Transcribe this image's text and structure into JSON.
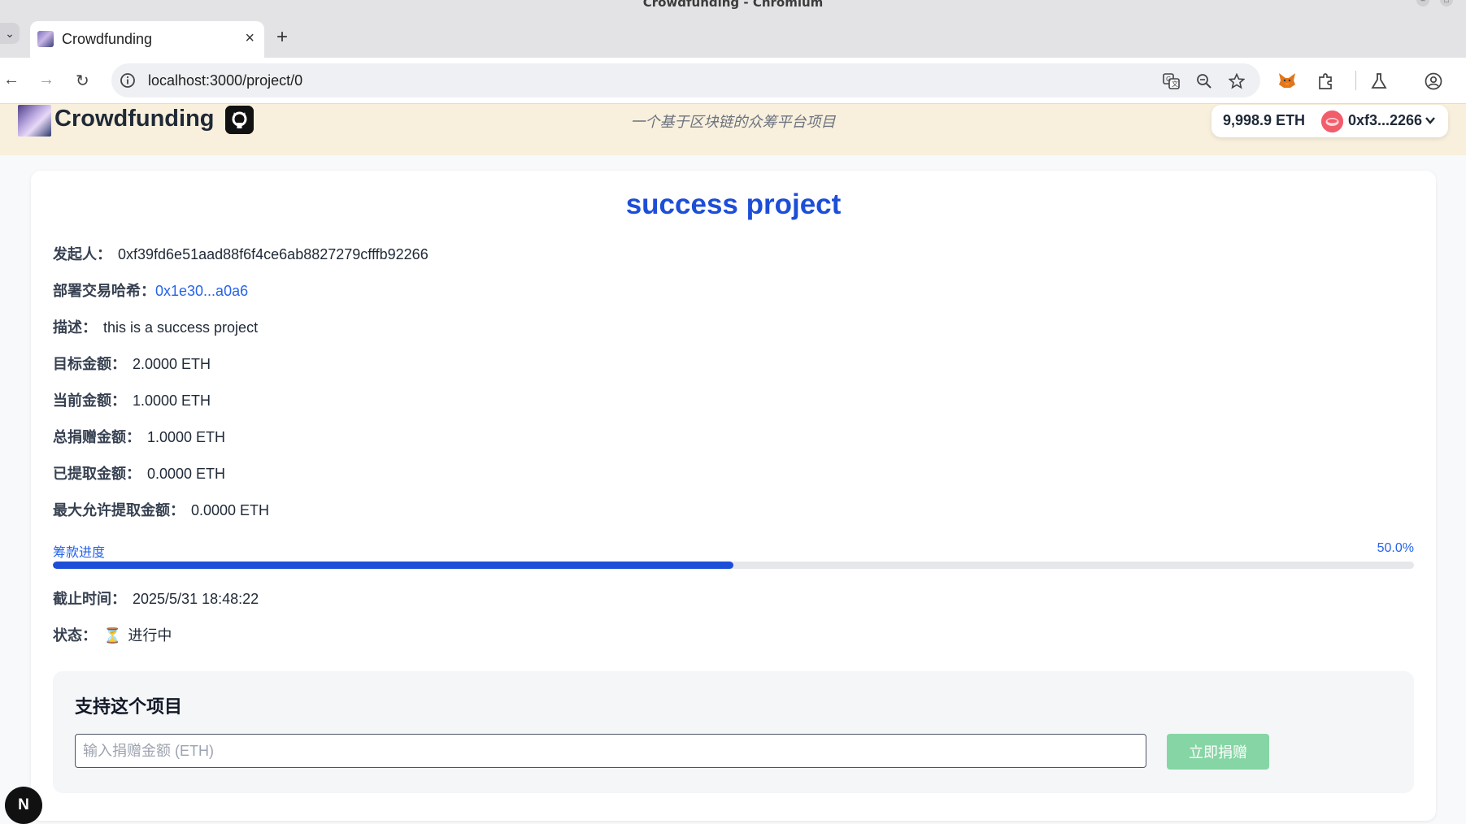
{
  "browser": {
    "window_title": "Crowdfunding - Chromium",
    "tab": {
      "title": "Crowdfunding",
      "close_glyph": "×"
    },
    "new_tab_glyph": "+",
    "tab_list_glyph": "⌄",
    "back_glyph": "←",
    "forward_glyph": "→",
    "reload_glyph": "↻",
    "url": "localhost:3000/project/0",
    "icons": [
      "translate-icon",
      "zoom-icon",
      "bookmark-star-icon",
      "metamask-fox-icon",
      "extensions-icon",
      "labs-flask-icon",
      "profile-icon"
    ]
  },
  "header": {
    "brand": "Crowdfunding",
    "tagline": "一个基于区块链的众筹平台项目",
    "wallet": {
      "balance": "9,998.9 ETH",
      "address": "0xf3...2266"
    }
  },
  "project": {
    "title": "success project",
    "fields": {
      "initiator": {
        "label": "发起人：",
        "value": "0xf39fd6e51aad88f6f4ce6ab8827279cfffb92266"
      },
      "deploy_tx": {
        "label": "部署交易哈希：",
        "value": "0x1e30...a0a6"
      },
      "description": {
        "label": "描述：",
        "value": "this is a success project"
      },
      "target": {
        "label": "目标金额：",
        "value": "2.0000 ETH"
      },
      "current": {
        "label": "当前金额：",
        "value": "1.0000 ETH"
      },
      "total_donated": {
        "label": "总捐赠金额：",
        "value": "1.0000 ETH"
      },
      "withdrawn": {
        "label": "已提取金额：",
        "value": "0.0000 ETH"
      },
      "max_withdraw": {
        "label": "最大允许提取金额：",
        "value": "0.0000 ETH"
      },
      "deadline": {
        "label": "截止时间：",
        "value": "2025/5/31 18:48:22"
      },
      "status": {
        "label": "状态：",
        "icon": "⏳",
        "value": "进行中"
      }
    },
    "progress": {
      "label": "筹款进度",
      "percent_text": "50.0%",
      "fraction": 0.5
    }
  },
  "support": {
    "heading": "支持这个项目",
    "input_placeholder": "输入捐赠金额 (ETH)",
    "button_label": "立即捐赠"
  },
  "dev_badge": "N",
  "colors": {
    "accent_blue": "#1d4ed8",
    "link_blue": "#2563eb",
    "header_bg": "#f8f0dc",
    "donate_green": "#86d5a4"
  }
}
